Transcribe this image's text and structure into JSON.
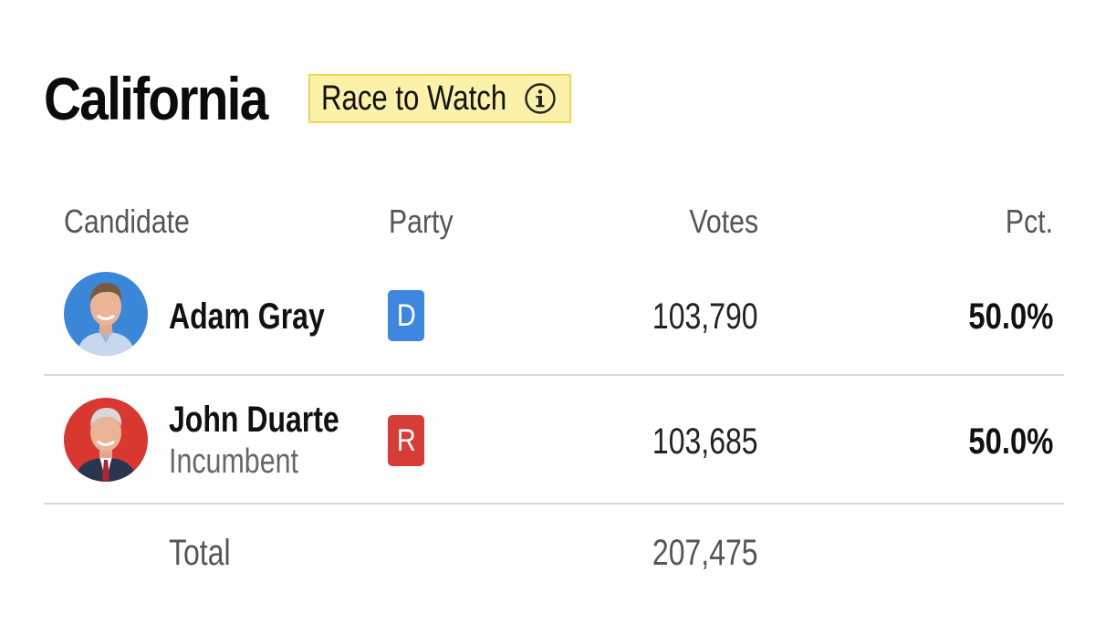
{
  "state": {
    "title": "California",
    "badge_label": "Race to Watch",
    "badge_icon": "info-icon"
  },
  "columns": {
    "candidate": "Candidate",
    "party": "Party",
    "votes": "Votes",
    "pct": "Pct."
  },
  "candidates": [
    {
      "name": "Adam Gray",
      "subtitle": "",
      "party": "D",
      "party_color": "#3d87e0",
      "avatar_bg": "#3a86d8",
      "votes": "103,790",
      "pct": "50.0%"
    },
    {
      "name": "John Duarte",
      "subtitle": "Incumbent",
      "party": "R",
      "party_color": "#d63d36",
      "avatar_bg": "#d8382f",
      "votes": "103,685",
      "pct": "50.0%"
    }
  ],
  "total": {
    "label": "Total",
    "votes": "207,475"
  }
}
